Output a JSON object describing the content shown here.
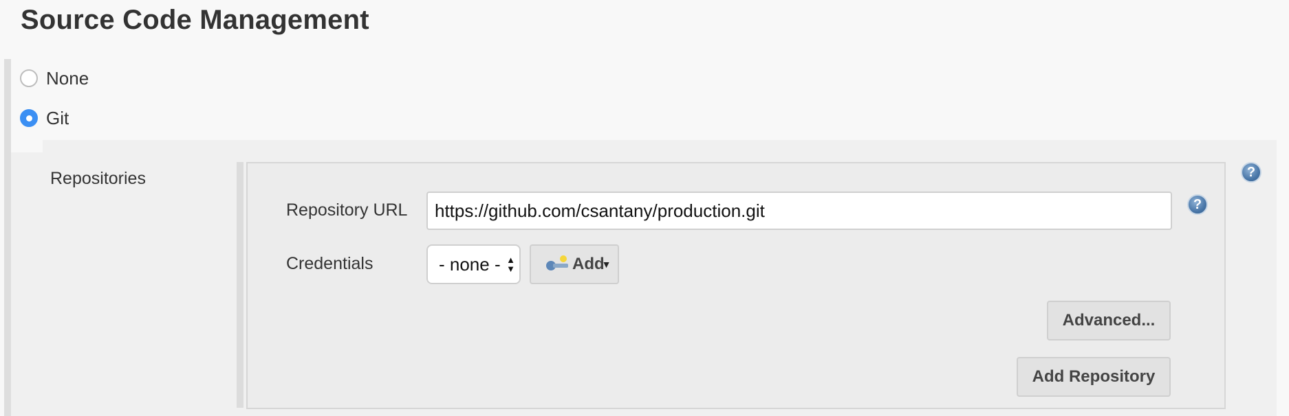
{
  "section": {
    "title": "Source Code Management"
  },
  "scm_options": [
    {
      "label": "None",
      "checked": false
    },
    {
      "label": "Git",
      "checked": true
    }
  ],
  "git": {
    "repositories_label": "Repositories",
    "help_glyph": "?",
    "repository_url": {
      "label": "Repository URL",
      "value": "https://github.com/csantany/production.git"
    },
    "credentials": {
      "label": "Credentials",
      "selected": "- none -",
      "add_button": "Add"
    },
    "advanced_button": "Advanced...",
    "add_repository_button": "Add Repository"
  },
  "colors": {
    "radio_checked": "#3b8ff3",
    "help_icon": "#4a77a8",
    "panel_bg": "#f0f0f0"
  }
}
